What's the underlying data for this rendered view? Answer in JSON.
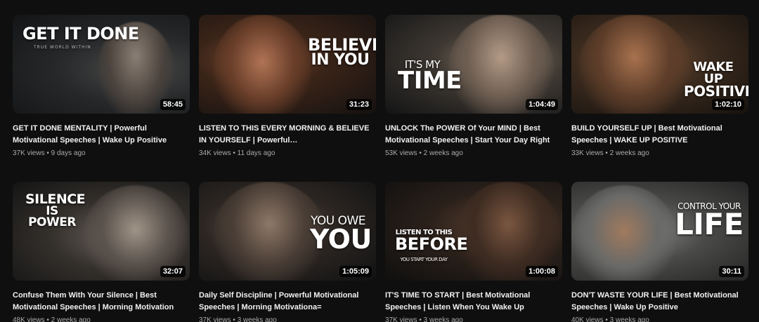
{
  "videos": [
    {
      "title": "GET IT DONE MENTALITY | Powerful Motivational Speeches | Wake Up Positive",
      "views": "37K views",
      "age": "9 days ago",
      "duration": "58:45",
      "overlay": [
        "GET IT DONE"
      ],
      "overlay_small": "TRUE WORLD WITHIN",
      "colors": {
        "bg": "#1c1f22",
        "accent": "#4a4a48"
      }
    },
    {
      "title": "LISTEN TO THIS EVERY MORNING & BELIEVE IN YOURSELF | Powerful…",
      "views": "34K views",
      "age": "11 days ago",
      "duration": "31:23",
      "overlay": [
        "BELIEVE",
        "IN YOU"
      ],
      "colors": {
        "bg": "#1b1512",
        "accent": "#7a4a30"
      }
    },
    {
      "title": "UNLOCK The POWER Of Your MIND | Best Motivational Speeches | Start Your Day Right",
      "views": "53K views",
      "age": "2 weeks ago",
      "duration": "1:04:49",
      "overlay": [
        "IT'S MY",
        "TIME"
      ],
      "colors": {
        "bg": "#18191a",
        "accent": "#8a7a6a"
      }
    },
    {
      "title": "BUILD YOURSELF UP | Best Motivational Speeches | WAKE UP POSITIVE",
      "views": "33K views",
      "age": "2 weeks ago",
      "duration": "1:02:10",
      "overlay": [
        "WAKE UP",
        "POSITIVE"
      ],
      "colors": {
        "bg": "#1e1712",
        "accent": "#7a5236"
      }
    },
    {
      "title": "Confuse Them With Your Silence | Best Motivational Speeches | Morning Motivation",
      "views": "48K views",
      "age": "2 weeks ago",
      "duration": "32:07",
      "overlay": [
        "SILENCE",
        "IS POWER"
      ],
      "colors": {
        "bg": "#1a1a1a",
        "accent": "#6a625c"
      }
    },
    {
      "title": "Daily Self Discipline | Powerful Motivational Speeches | Morning Motivationa=",
      "views": "37K views",
      "age": "3 weeks ago",
      "duration": "1:05:09",
      "overlay": [
        "YOU OWE",
        "YOU"
      ],
      "colors": {
        "bg": "#141516",
        "accent": "#5a4c42"
      }
    },
    {
      "title": "IT'S TIME TO START | Best Motivational Speeches | Listen When You Wake Up",
      "views": "37K views",
      "age": "3 weeks ago",
      "duration": "1:00:08",
      "overlay": [
        "LISTEN TO THIS",
        "BEFORE"
      ],
      "overlay_small": "YOU START YOUR DAY",
      "colors": {
        "bg": "#131313",
        "accent": "#5c4232"
      }
    },
    {
      "title": "DON'T WASTE YOUR LIFE | Best Motivational Speeches | Wake Up Positive",
      "views": "40K views",
      "age": "3 weeks ago",
      "duration": "30:11",
      "overlay": [
        "CONTROL YOUR",
        "LIFE"
      ],
      "colors": {
        "bg": "#2a2a2a",
        "accent": "#8a8a88"
      }
    }
  ]
}
